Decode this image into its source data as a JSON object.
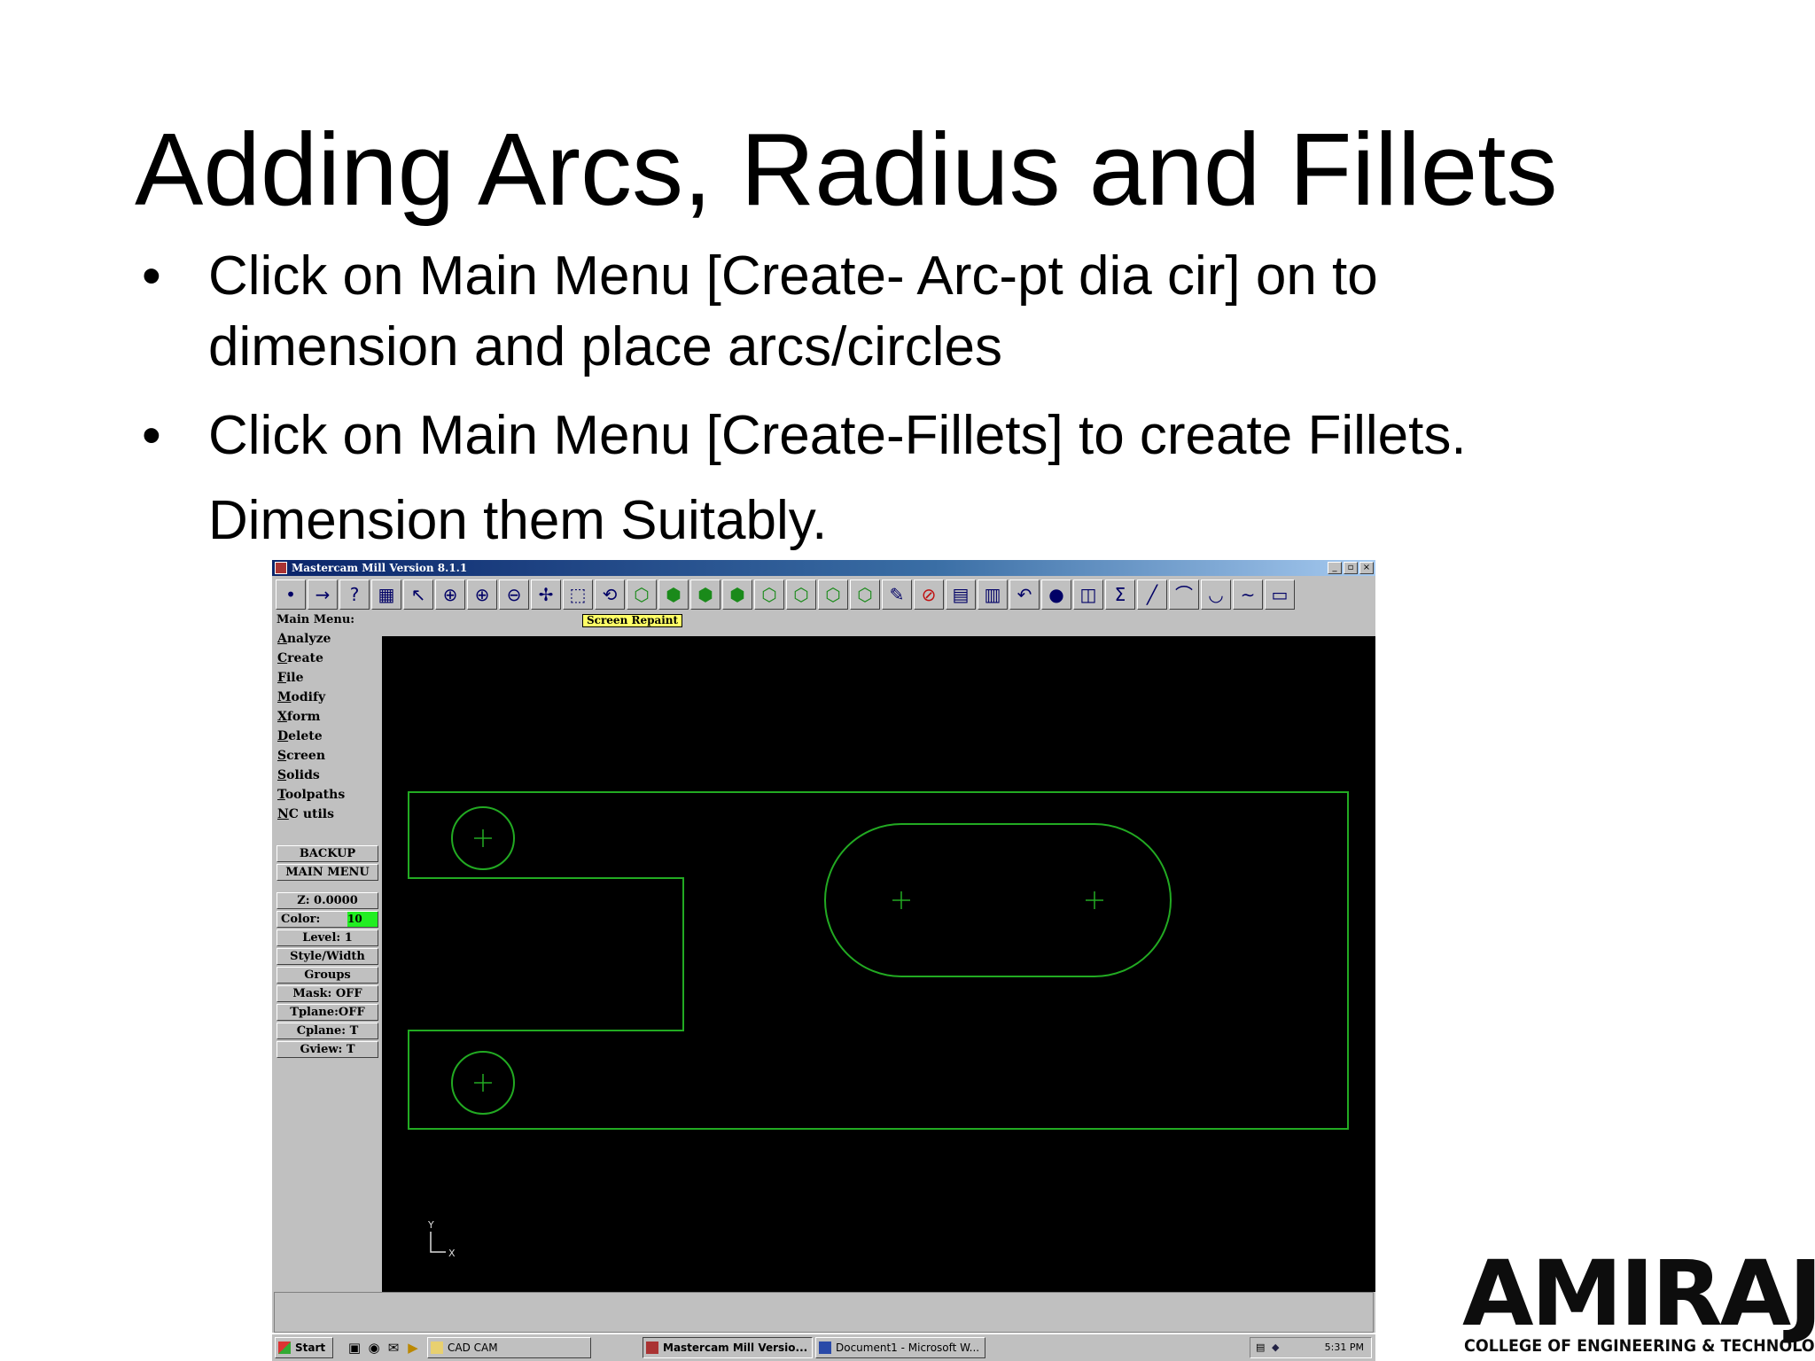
{
  "slide": {
    "title": "Adding Arcs, Radius and Fillets",
    "bullets": [
      {
        "line1": "Click on Main Menu [Create- Arc-pt dia cir] on to",
        "line2": "dimension and place arcs/circles"
      },
      {
        "line1": "Click on Main Menu [Create-Fillets] to create Fillets.",
        "line2": "Dimension them Suitably."
      }
    ],
    "bullet_char": "•"
  },
  "window": {
    "title": "Mastercam Mill Version 8.1.1",
    "controls": [
      "_",
      "▫",
      "×"
    ],
    "prompt": "Main Menu:",
    "hint": "Screen Repaint"
  },
  "toolbar": {
    "icons": [
      "dot-icon",
      "arrow-icon",
      "help-icon",
      "calculator-icon",
      "pointer-help-icon",
      "zoom-window-icon",
      "zoom-in-icon",
      "zoom-out-icon",
      "pan-icon",
      "select-icon",
      "rotate-icon",
      "iso-view-icon",
      "top-view-icon",
      "front-view-icon",
      "side-view-icon",
      "box-view-1-icon",
      "box-view-2-icon",
      "box-view-3-icon",
      "box-view-4-icon",
      "pencil-icon",
      "no-entry-icon",
      "display-icon",
      "layers-icon",
      "undo-icon",
      "sphere-icon",
      "shapes-icon",
      "sigma-icon",
      "line-icon",
      "arc-icon",
      "fillet-icon",
      "spline-icon",
      "rectangle-icon"
    ],
    "glyphs": [
      "•",
      "→",
      "?",
      "▦",
      "↖",
      "⊕",
      "⊕",
      "⊖",
      "✢",
      "⬚",
      "⟲",
      "⬡",
      "⬢",
      "⬢",
      "⬢",
      "⬡",
      "⬡",
      "⬡",
      "⬡",
      "✎",
      "⊘",
      "▤",
      "▥",
      "↶",
      "●",
      "◫",
      "Σ",
      "╱",
      "⌒",
      "◡",
      "∼",
      "▭"
    ]
  },
  "menu": {
    "items": [
      "Analyze",
      "Create",
      "File",
      "Modify",
      "Xform",
      "Delete",
      "Screen",
      "Solids",
      "Toolpaths",
      "NC utils"
    ],
    "backup": "BACKUP",
    "main_menu": "MAIN MENU"
  },
  "params": {
    "z": "Z: 0.0000",
    "color_label": "Color:",
    "color_value": "10",
    "level": "Level: 1",
    "style": "Style/Width",
    "groups": "Groups",
    "mask": "Mask: OFF",
    "tplane": "Tplane:OFF",
    "cplane": "Cplane: T",
    "gview": "Gview: T"
  },
  "axes": {
    "y": "Y",
    "x": "X"
  },
  "taskbar": {
    "start": "Start",
    "folder": "CAD CAM",
    "app1": "Mastercam Mill Versio...",
    "app2": "Document1 - Microsoft W...",
    "time": "5:31 PM"
  },
  "logo": {
    "brand": "AMIRAJ",
    "subtitle": "COLLEGE OF ENGINEERING & TECHNOLOGY"
  },
  "colors": {
    "geometry": "#22aa22",
    "viewport": "#000000",
    "highlight": "#22ee22"
  }
}
